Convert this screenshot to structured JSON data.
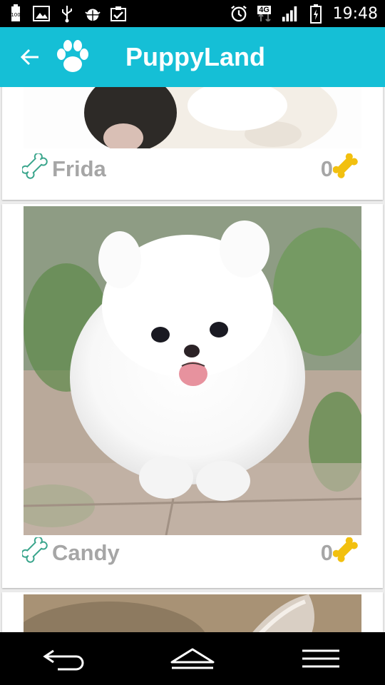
{
  "status_bar": {
    "time": "19:48",
    "network": "4G",
    "left_icons": [
      "battery-100-icon",
      "image-icon",
      "usb-icon",
      "android-debug-icon",
      "checklist-icon"
    ],
    "right_icons": [
      "alarm-icon",
      "4g-icon",
      "signal-icon",
      "battery-charging-icon"
    ]
  },
  "app_bar": {
    "title": "PuppyLand",
    "back_icon": "arrow-back-icon",
    "logo_icon": "paw-icon",
    "color": "#15bfd6"
  },
  "cards": [
    {
      "name": "Frida",
      "likes": "0"
    },
    {
      "name": "Candy",
      "likes": "0"
    },
    {
      "name": "",
      "likes": ""
    }
  ],
  "colors": {
    "bone_outline": "#3aa58c",
    "bone_filled": "#f2c00f",
    "text_gray": "#a6a6a6"
  },
  "nav_bar": {
    "icons": [
      "back-nav-icon",
      "home-nav-icon",
      "menu-nav-icon"
    ]
  }
}
